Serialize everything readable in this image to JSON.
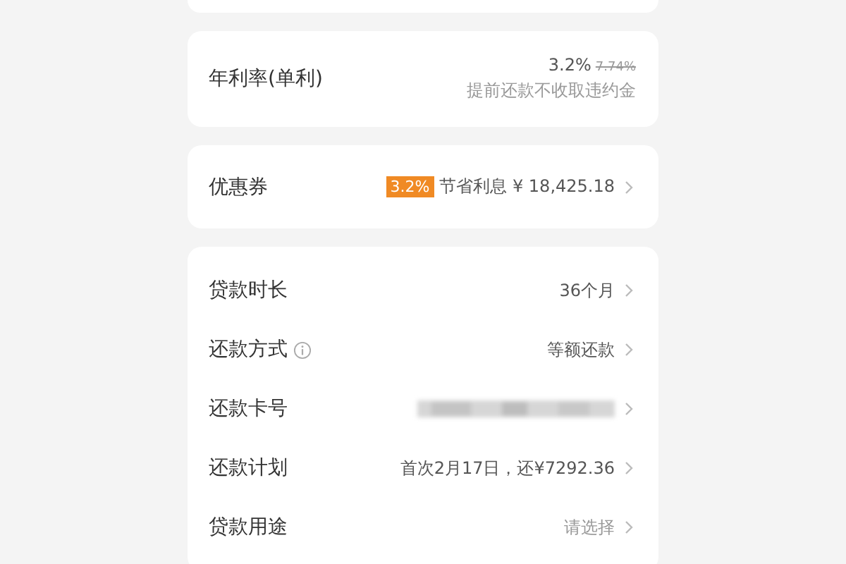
{
  "rate": {
    "label": "年利率(单利)",
    "rate": "3.2%",
    "original_rate": "7.74%",
    "note": "提前还款不收取违约金"
  },
  "coupon": {
    "label": "优惠券",
    "badge": "3.2%",
    "savings": "节省利息 ¥ 18,425.18"
  },
  "details": [
    {
      "label": "贷款时长",
      "kind": "value",
      "value": "36个月",
      "info": false
    },
    {
      "label": "还款方式",
      "kind": "value",
      "value": "等额还款",
      "info": true
    },
    {
      "label": "还款卡号",
      "kind": "blurred",
      "info": false
    },
    {
      "label": "还款计划",
      "kind": "value",
      "value": "首次2月17日，还¥7292.36",
      "info": false
    },
    {
      "label": "贷款用途",
      "kind": "placeholder",
      "placeholder": "请选择",
      "info": false
    }
  ]
}
